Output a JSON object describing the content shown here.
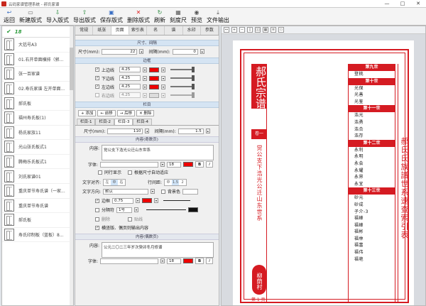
{
  "window": {
    "title": "云码家谱管理系统 - 郝氏家谱",
    "min": "—",
    "max": "□",
    "close": "✕"
  },
  "toolbar": [
    {
      "label": "返回",
      "icon": "back-icon"
    },
    {
      "label": "新建版式",
      "icon": "new-icon"
    },
    {
      "label": "导入版式",
      "icon": "import-icon"
    },
    {
      "label": "导出版式",
      "icon": "export-icon"
    },
    {
      "label": "保存版式",
      "icon": "save-icon"
    },
    {
      "label": "删除版式",
      "icon": "delete-icon"
    },
    {
      "label": "刷新",
      "icon": "refresh-icon"
    },
    {
      "label": "刻度尺",
      "icon": "ruler-icon"
    },
    {
      "label": "预览",
      "icon": "preview-icon"
    },
    {
      "label": "文件输出",
      "icon": "output-icon"
    }
  ],
  "left": {
    "count": "18",
    "items": [
      "大括号A3",
      "01.右开单面横排（郭...",
      "张一百家谱",
      "02.寿氏家谱 左开单面...",
      "郝氏板",
      "福州寿氏板(1)",
      "杨氏家族11",
      "光山张氏板式1",
      "腾梅乐氏板式1",
      "刘氏家谱01",
      "重庆单节寿氏谱（一家...",
      "重庆单节寿氏谱",
      "郝氏板",
      "寿氏印制板（蓝板）8..."
    ]
  },
  "mid": {
    "tabs": [
      "常规",
      "纸张",
      "页面",
      "索引表",
      "名",
      "谱",
      "水印",
      "参数"
    ],
    "active_tab": "页面",
    "sec_size": "尺寸、间隔",
    "size_label": "尺寸(mm):",
    "size_value": "22",
    "spacing_label": "间隔(mm):",
    "spacing_value": "0",
    "sec_border": "边框",
    "borders": [
      {
        "label": "上边线",
        "value": "4.25",
        "checked": true
      },
      {
        "label": "下边线",
        "value": "4.25",
        "checked": true
      },
      {
        "label": "左边线",
        "value": "4.25",
        "checked": true
      },
      {
        "label": "右边线",
        "value": "4.25",
        "checked": false
      }
    ],
    "sec_column": "栏目",
    "col_buttons": [
      "+ 添加",
      "← 前移",
      "→ 后移",
      "✕ 删除"
    ],
    "subtabs": [
      "栏目-1",
      "栏目-2",
      "栏目-3",
      "栏目-4"
    ],
    "col_size_label": "尺寸(mm):",
    "col_size_value": "110",
    "col_spacing_label": "间隔(mm):",
    "col_spacing_value": "1.5",
    "sec_odd": "内容(奇数页)",
    "content_label": "内容:",
    "odd_content": "觉公支下浩光公迁山东世系",
    "font_label": "字体:",
    "font_size": "18",
    "odd_opt1": "同行显示",
    "odd_opt2": "根据尺寸自动适应",
    "align_label": "文字对齐:",
    "align_opts": [
      "左",
      "中",
      "右"
    ],
    "spacing2_label": "行间距:",
    "spacing_opts": [
      "中",
      "1.5",
      "2"
    ],
    "dir_label": "文字方向:",
    "dir_value": "默认",
    "bg_label": "背景色",
    "frame_label": "边框",
    "frame_value": "0.75",
    "divider_label": "分隔符",
    "divider_value": "1号",
    "opt_a": "删除",
    "opt_b": "贴线",
    "fill_note": "横竖版、偶页则输出内容",
    "sec_even": "内容(偶数页)",
    "even_content": "公元二〇二三年岁次癸卯冬月修谱"
  },
  "preview": {
    "banner": "郝氏宗谱",
    "fish": "卷一",
    "vtext": "觉公支下浩光公迁山东世系",
    "seal": "柳荫村",
    "pagenum": "第 1 页",
    "right_title": "郝氏氏族譜世系速查索引表",
    "generations": [
      {
        "title": "第九世",
        "names": [
          "登桃"
        ]
      },
      {
        "title": "第十世",
        "names": [
          "光保",
          "光善",
          "光鉴"
        ]
      },
      {
        "title": "第十一世",
        "names": [
          "浩光",
          "浩勇",
          "浩合",
          "浩存"
        ]
      },
      {
        "title": "第十二世",
        "names": [
          "永利",
          "永明",
          "永会",
          "永耀",
          "永界",
          "永宜"
        ]
      },
      {
        "title": "第十三世",
        "names": [
          "砂元",
          "砂成",
          "子介-3",
          "福峰",
          "福峰",
          "福彬",
          "福林",
          "福富",
          "福伟",
          "福艳"
        ]
      }
    ]
  }
}
